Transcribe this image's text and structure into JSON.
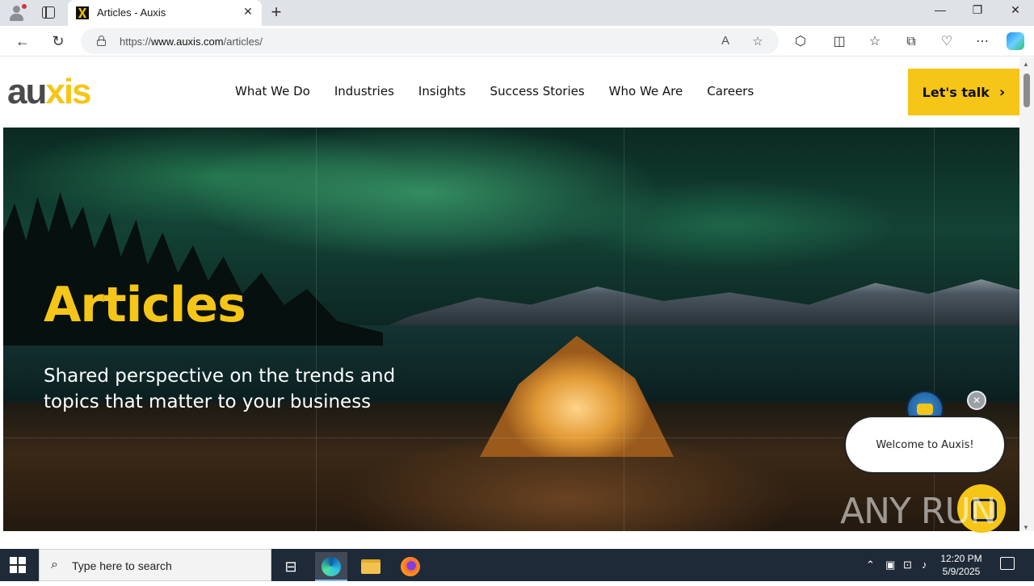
{
  "browser": {
    "tab_title": "Articles - Auxis",
    "url_prefix": "https://",
    "url_domain": "www.auxis.com",
    "url_path": "/articles/",
    "new_tab_label": "+",
    "tab_close": "✕",
    "window_controls": {
      "minimize": "—",
      "restore": "❐",
      "close": "✕"
    }
  },
  "site": {
    "logo": {
      "part1": "au",
      "part2": "xis"
    },
    "nav": [
      "What We Do",
      "Industries",
      "Insights",
      "Success Stories",
      "Who We Are",
      "Careers"
    ],
    "cta": {
      "label": "Let's talk",
      "arrow": "›"
    }
  },
  "hero": {
    "title": "Articles",
    "subtitle": "Shared perspective on the trends and topics that matter to your business"
  },
  "chat": {
    "greeting": "Welcome to Auxis!",
    "close": "✕"
  },
  "watermark": "ANY RUN",
  "taskbar": {
    "search_placeholder": "Type here to search",
    "time": "12:20 PM",
    "date": "5/9/2025"
  },
  "colors": {
    "brand_yellow": "#f5c518",
    "logo_gray": "#4a4a4a",
    "taskbar": "#1f2a38"
  }
}
